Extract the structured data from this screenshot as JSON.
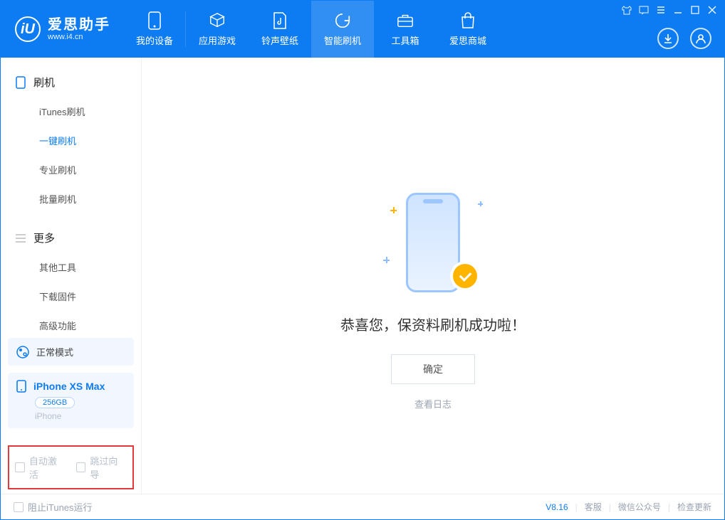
{
  "app": {
    "name": "爱思助手",
    "url": "www.i4.cn",
    "logo_letter": "iU"
  },
  "nav": [
    {
      "label": "我的设备"
    },
    {
      "label": "应用游戏"
    },
    {
      "label": "铃声壁纸"
    },
    {
      "label": "智能刷机"
    },
    {
      "label": "工具箱"
    },
    {
      "label": "爱思商城"
    }
  ],
  "sidebar": {
    "section1": {
      "title": "刷机",
      "items": [
        "iTunes刷机",
        "一键刷机",
        "专业刷机",
        "批量刷机"
      ]
    },
    "section2": {
      "title": "更多",
      "items": [
        "其他工具",
        "下载固件",
        "高级功能"
      ]
    },
    "mode": "正常模式",
    "device": {
      "name": "iPhone XS Max",
      "capacity": "256GB",
      "type": "iPhone"
    },
    "checks": {
      "auto_activate": "自动激活",
      "skip_guide": "跳过向导"
    }
  },
  "main": {
    "message": "恭喜您，保资料刷机成功啦！",
    "ok": "确定",
    "view_log": "查看日志"
  },
  "footer": {
    "block_itunes": "阻止iTunes运行",
    "version": "V8.16",
    "service": "客服",
    "wechat": "微信公众号",
    "check_update": "检查更新"
  }
}
